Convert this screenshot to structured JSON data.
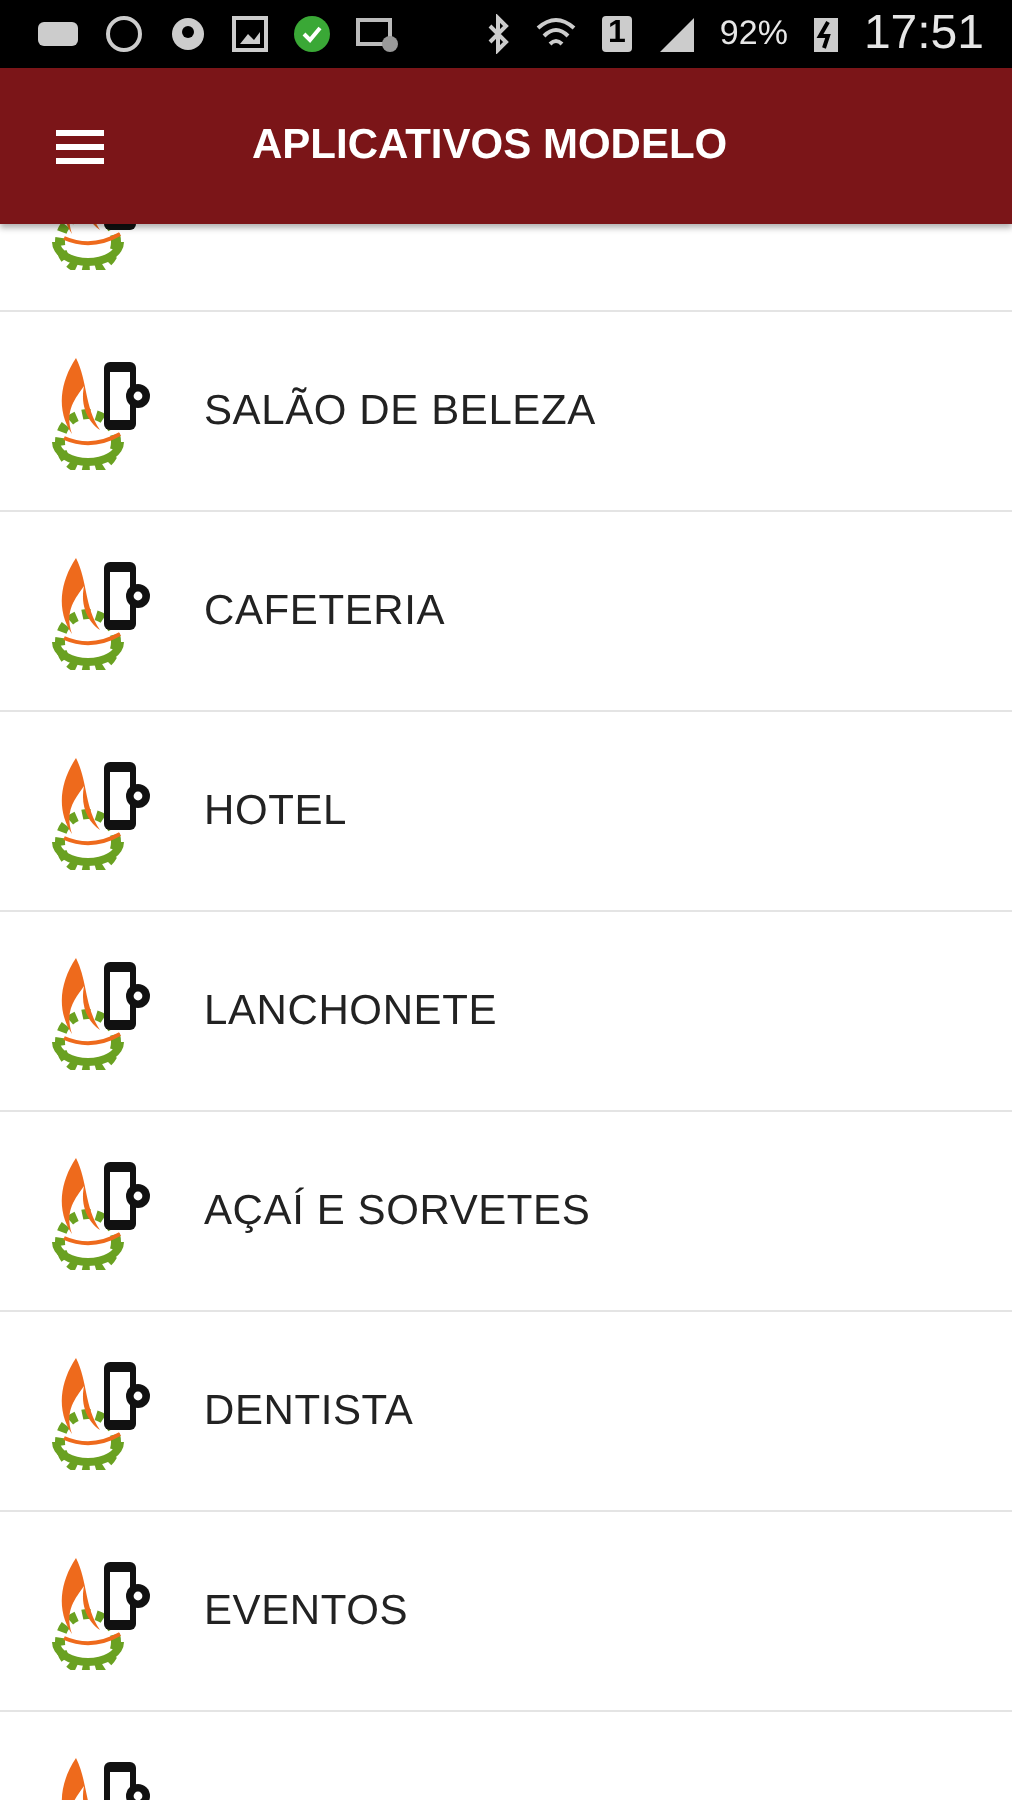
{
  "status_bar": {
    "sim_slot": "1",
    "battery": "92%",
    "time": "17:51"
  },
  "app_bar": {
    "title": "APLICATIVOS MODELO"
  },
  "cut_off_rows": {
    "above": true,
    "below": true
  },
  "items": [
    {
      "label": "SALÃO DE BELEZA"
    },
    {
      "label": "CAFETERIA"
    },
    {
      "label": "HOTEL"
    },
    {
      "label": "LANCHONETE"
    },
    {
      "label": "AÇAÍ E SORVETES"
    },
    {
      "label": "DENTISTA"
    },
    {
      "label": "EVENTOS"
    }
  ]
}
